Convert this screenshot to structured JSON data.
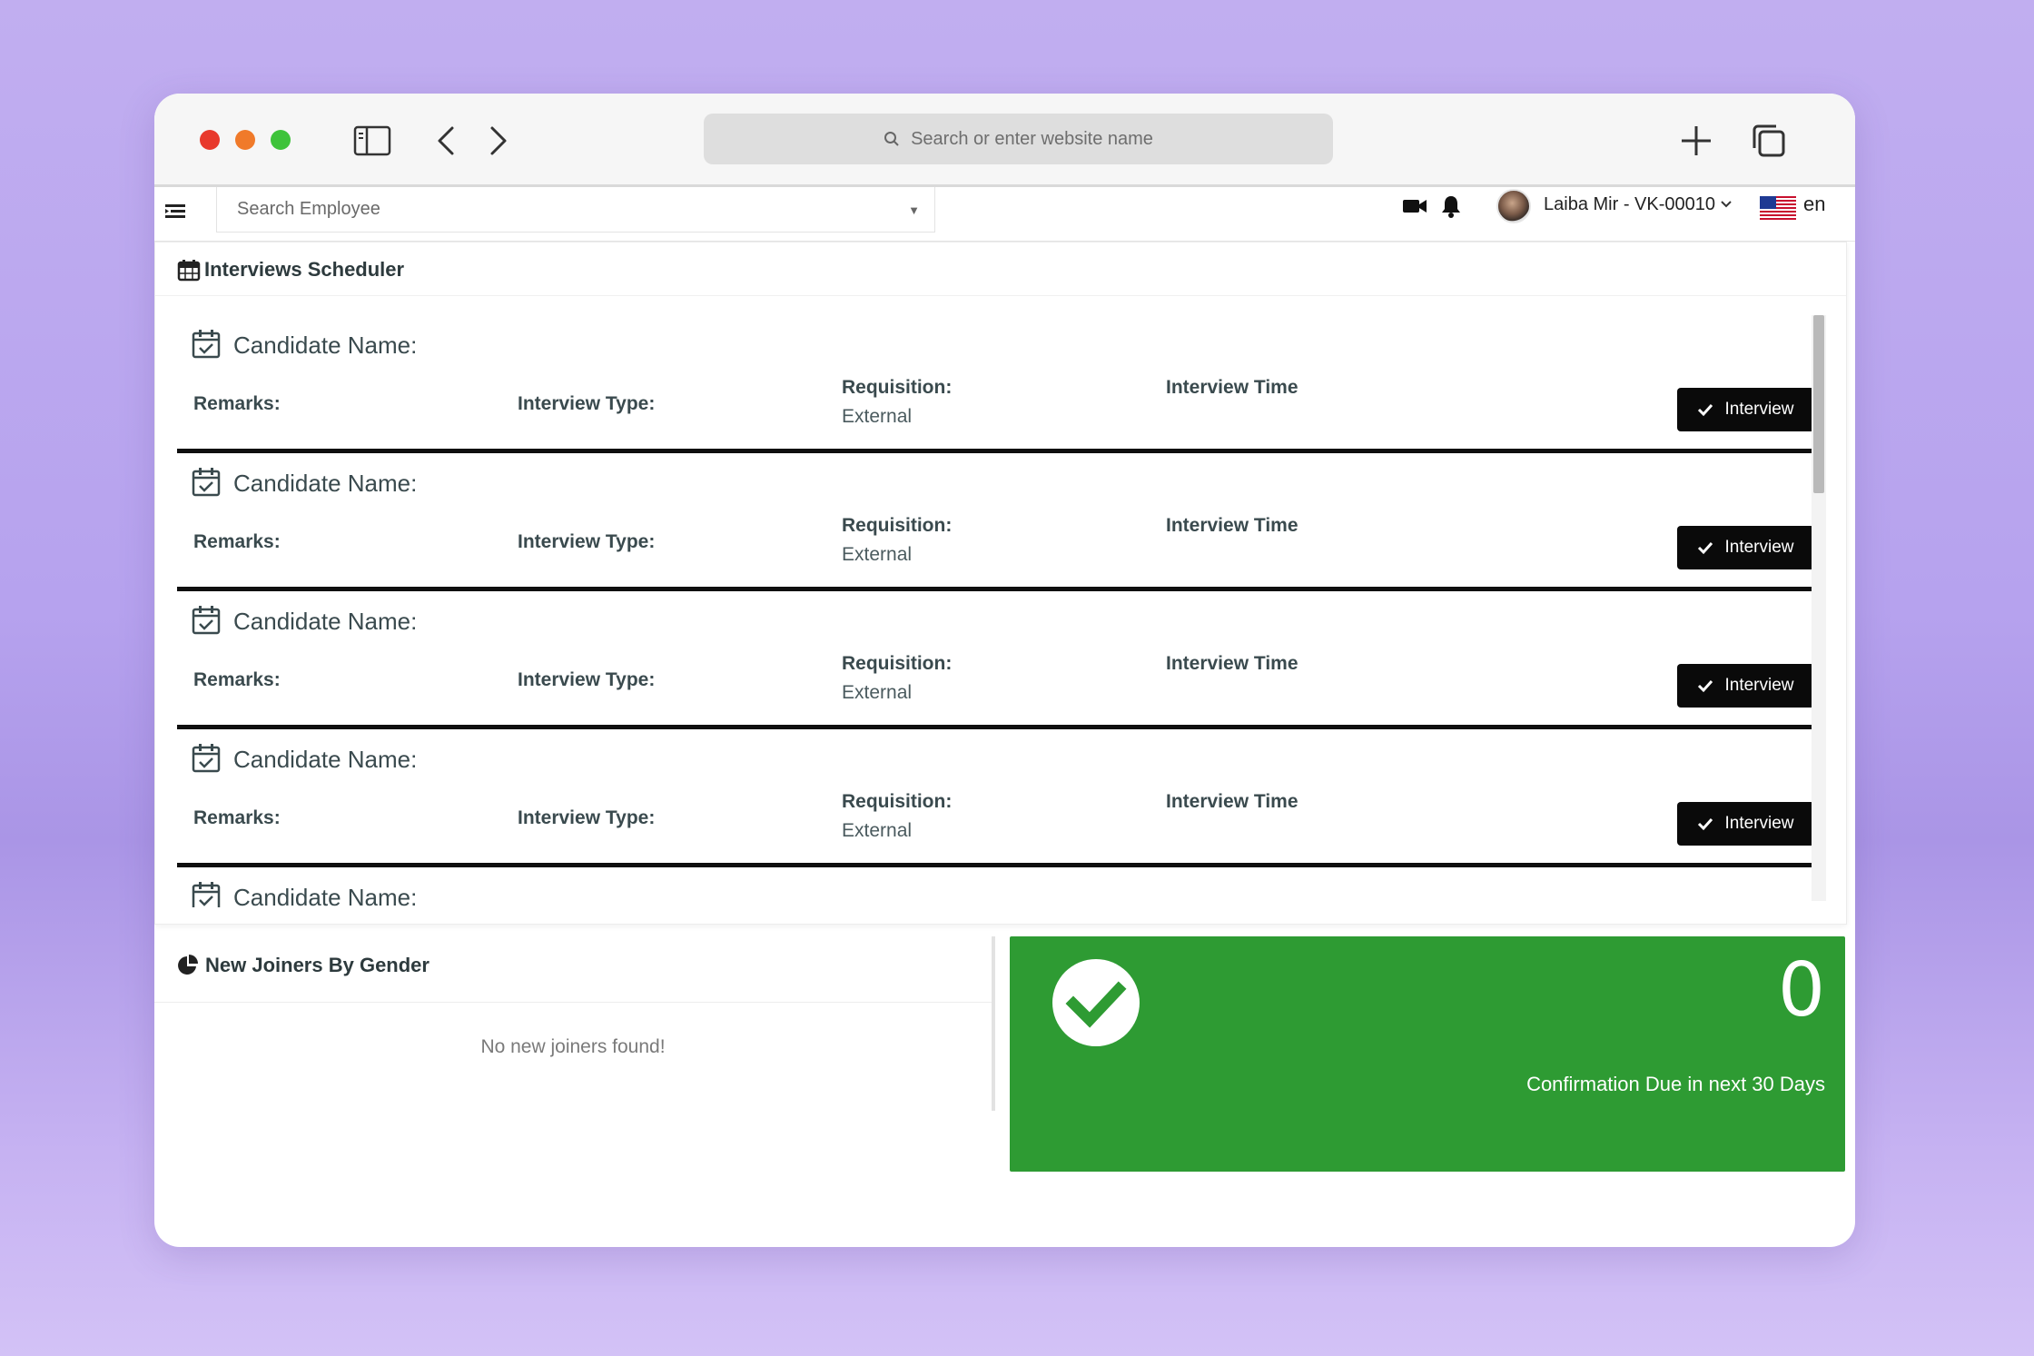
{
  "browser": {
    "address_placeholder": "Search or enter website name"
  },
  "header": {
    "search_placeholder": "Search Employee",
    "user_name": "Laiba Mir - VK-00010",
    "language": "en"
  },
  "interviews": {
    "title": "Interviews Scheduler",
    "rows": [
      {
        "candidate": "Candidate Name:",
        "remarks": "Remarks:",
        "type": "Interview Type:",
        "req_label": "Requisition:",
        "req_value": "External",
        "time": "Interview Time",
        "button": "Interview"
      },
      {
        "candidate": "Candidate Name:",
        "remarks": "Remarks:",
        "type": "Interview Type:",
        "req_label": "Requisition:",
        "req_value": "External",
        "time": "Interview Time",
        "button": "Interview"
      },
      {
        "candidate": "Candidate Name:",
        "remarks": "Remarks:",
        "type": "Interview Type:",
        "req_label": "Requisition:",
        "req_value": "External",
        "time": "Interview Time",
        "button": "Interview"
      },
      {
        "candidate": "Candidate Name:",
        "remarks": "Remarks:",
        "type": "Interview Type:",
        "req_label": "Requisition:",
        "req_value": "External",
        "time": "Interview Time",
        "button": "Interview"
      },
      {
        "candidate": "Candidate Name:"
      }
    ]
  },
  "joiners": {
    "title": "New Joiners By Gender",
    "empty_text": "No new joiners found!"
  },
  "confirmation": {
    "count": "0",
    "caption": "Confirmation Due in next 30 Days",
    "color": "#2e9b33"
  },
  "icons": [
    "sidebar-toggle-icon",
    "back-icon",
    "forward-icon",
    "search-icon",
    "plus-icon",
    "tabs-icon",
    "menu-icon",
    "video-icon",
    "bell-icon",
    "calendar-icon",
    "calendar-check-icon",
    "check-icon",
    "pie-chart-icon",
    "flag-icon"
  ]
}
